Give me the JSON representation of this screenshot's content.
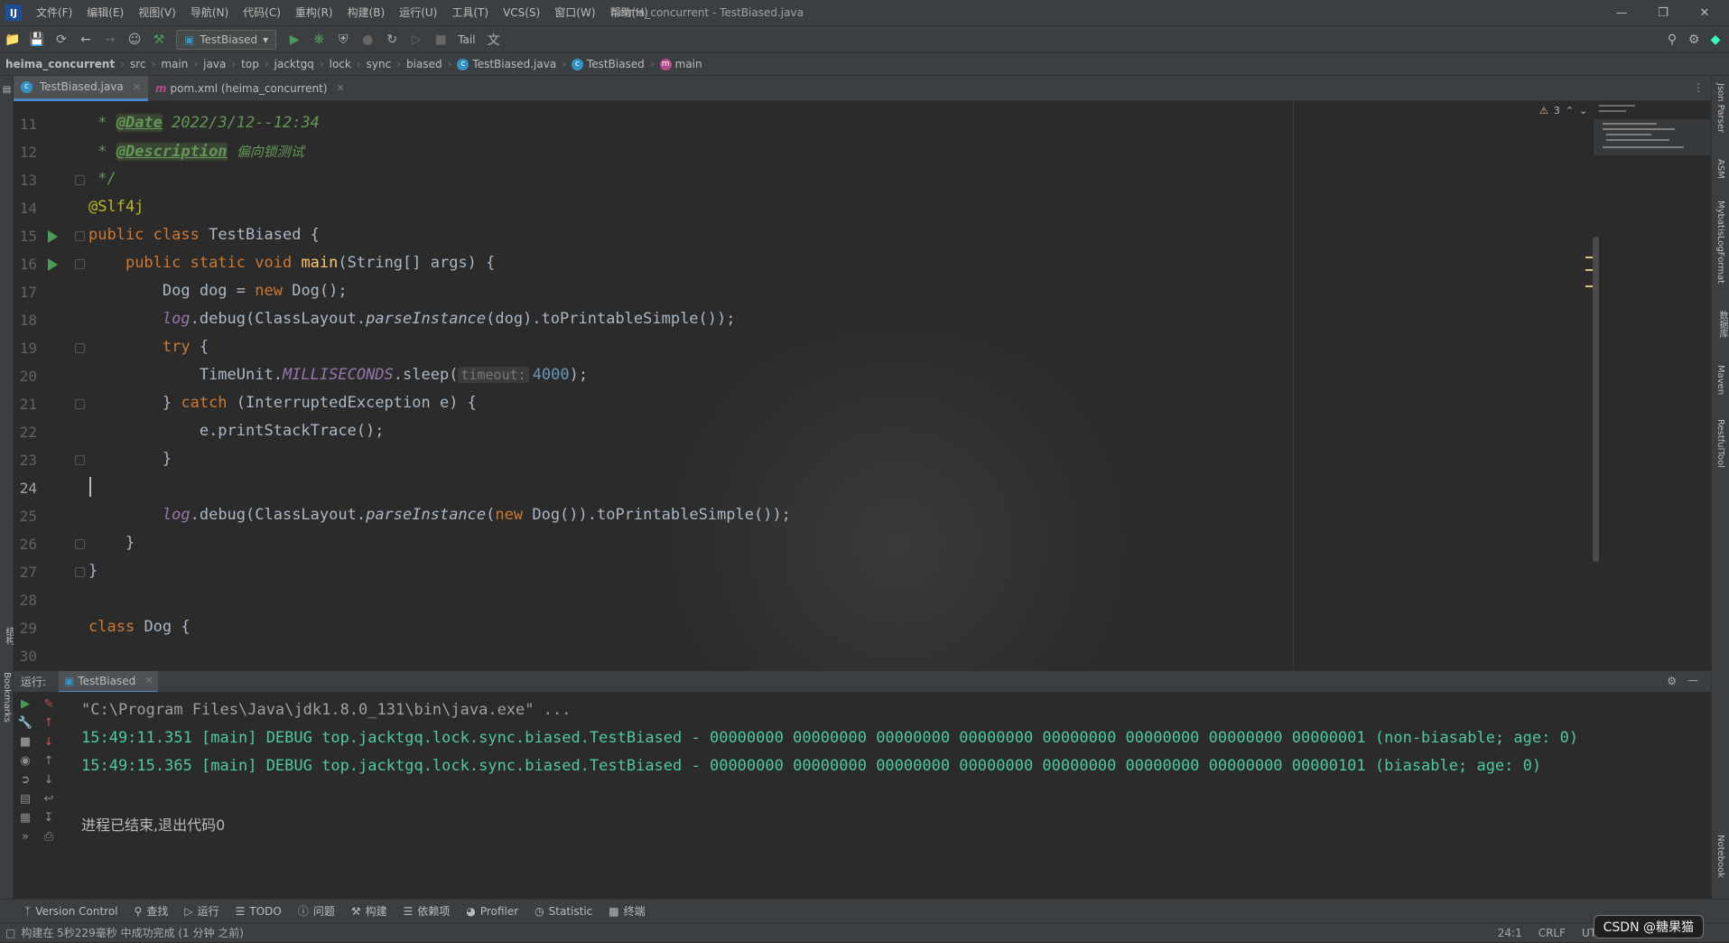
{
  "menubar": {
    "logo": "IJ",
    "items": [
      "文件(F)",
      "编辑(E)",
      "视图(V)",
      "导航(N)",
      "代码(C)",
      "重构(R)",
      "构建(B)",
      "运行(U)",
      "工具(T)",
      "VCS(S)",
      "窗口(W)",
      "帮助(H)"
    ],
    "window_title": "heima_concurrent - TestBiased.java"
  },
  "toolbar": {
    "run_config": "TestBiased",
    "tail_label": "Tail"
  },
  "breadcrumb": {
    "root": "heima_concurrent",
    "parts": [
      "src",
      "main",
      "java",
      "top",
      "jacktgq",
      "lock",
      "sync",
      "biased"
    ],
    "file": "TestBiased.java",
    "class_name": "TestBiased",
    "method": "main"
  },
  "tabs": [
    {
      "label": "TestBiased.java",
      "active": true
    },
    {
      "label": "pom.xml (heima_concurrent)",
      "active": false
    }
  ],
  "editor": {
    "warnings_count": "3",
    "line_numbers": [
      "11",
      "12",
      "13",
      "14",
      "15",
      "16",
      "17",
      "18",
      "19",
      "20",
      "21",
      "22",
      "23",
      "24",
      "25",
      "26",
      "27",
      "28",
      "29",
      "30"
    ],
    "current_line": "24",
    "l11_tag": "@Date",
    "l11_val": "2022/3/12--12:34",
    "l12_tag": "@Description",
    "l12_val": "偏向锁测试",
    "l13": "*/",
    "l14": "@Slf4j",
    "l15_kw": "public class",
    "l15_name": "TestBiased",
    "l16_kw": "public static void",
    "l16_fn": "main",
    "l16_rest": "(String[] args) {",
    "l17_a": "Dog dog = ",
    "l17_kw": "new",
    "l17_b": " Dog();",
    "l18_log": "log",
    "l18_a": ".debug(ClassLayout.",
    "l18_m": "parseInstance",
    "l18_b": "(dog).toPrintableSimple());",
    "l19_kw": "try",
    "l20_a": "TimeUnit.",
    "l20_c": "MILLISECONDS",
    "l20_b": ".sleep(",
    "l20_hint": "timeout:",
    "l20_num": "4000",
    "l20_end": ");",
    "l21_kw": "catch",
    "l21_rest": "(InterruptedException e) {",
    "l22": "e.printStackTrace();",
    "l25_log": "log",
    "l25_a": ".debug(ClassLayout.",
    "l25_m": "parseInstance",
    "l25_kw": "new",
    "l25_b": " Dog()).toPrintableSimple());",
    "l29_kw": "class",
    "l29_name": "Dog {"
  },
  "run": {
    "label": "运行:",
    "tab": "TestBiased",
    "cmd": "\"C:\\Program Files\\Java\\jdk1.8.0_131\\bin\\java.exe\" ...",
    "out1": "15:49:11.351 [main] DEBUG top.jacktgq.lock.sync.biased.TestBiased - 00000000 00000000 00000000 00000000 00000000 00000000 00000000 00000001 (non-biasable; age: 0)",
    "out2": "15:49:15.365 [main] DEBUG top.jacktgq.lock.sync.biased.TestBiased - 00000000 00000000 00000000 00000000 00000000 00000000 00000000 00000101 (biasable; age: 0)",
    "exit": "进程已结束,退出代码0"
  },
  "toolwindows": [
    "Version Control",
    "查找",
    "运行",
    "TODO",
    "问题",
    "构建",
    "依赖项",
    "Profiler",
    "Statistic",
    "终端"
  ],
  "sidebar_right": [
    "Json Parser",
    "ASM",
    "MybatisLogFormat",
    "数据库",
    "Maven",
    "RestfulTool",
    "Notebook"
  ],
  "sidebar_left": [
    "结构",
    "Bookmarks"
  ],
  "status": {
    "message": "构建在 5秒229毫秒 中成功完成 (1 分钟 之前)",
    "position": "24:1",
    "line_sep": "CRLF",
    "encoding": "UTF-8"
  },
  "watermark": "CSDN @糖果猫"
}
